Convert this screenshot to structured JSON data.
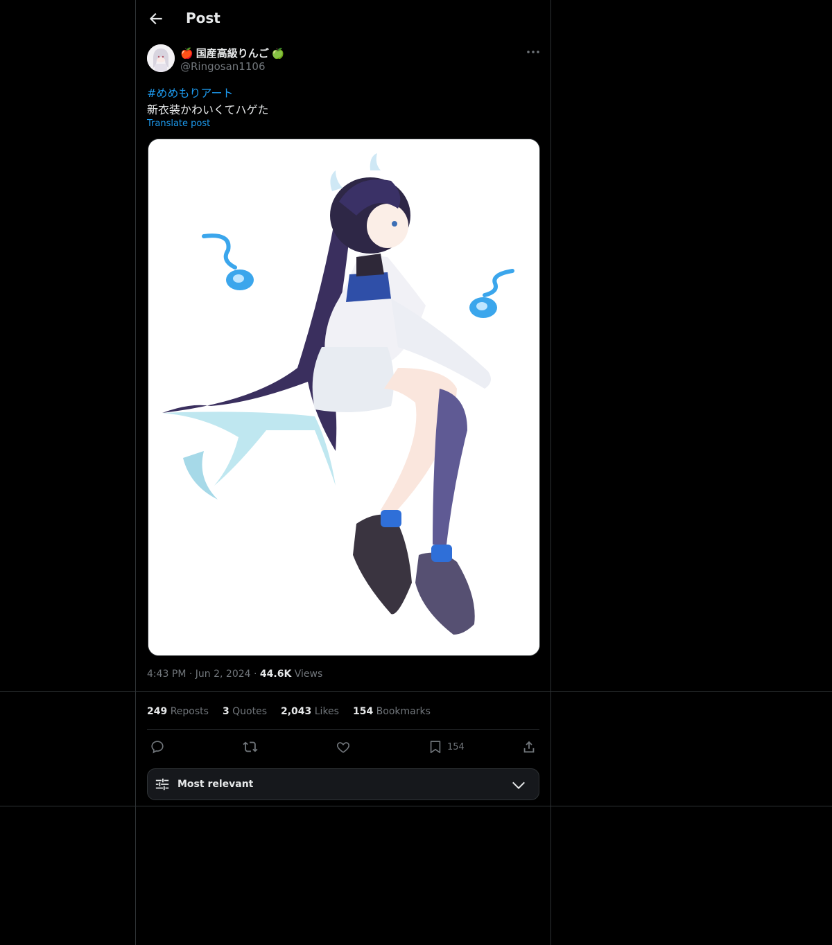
{
  "header": {
    "title": "Post"
  },
  "author": {
    "name": "国産高級りんご",
    "name_prefix_emoji": "🍎",
    "name_suffix_emoji": "🍏",
    "handle": "@Ringosan1106"
  },
  "post": {
    "hashtag": "#めめもりアート",
    "text": "新衣装かわいくてハゲた",
    "translate_label": "Translate post",
    "time": "4:43 PM",
    "date": "Jun 2, 2024",
    "views_count": "44.6K",
    "views_label": "Views"
  },
  "stats": {
    "reposts_count": "249",
    "reposts_label": "Reposts",
    "quotes_count": "3",
    "quotes_label": "Quotes",
    "likes_count": "2,043",
    "likes_label": "Likes",
    "bookmarks_count": "154",
    "bookmarks_label": "Bookmarks"
  },
  "actions": {
    "bookmark_count": "154"
  },
  "sort": {
    "label": "Most relevant"
  },
  "colors": {
    "accent": "#1d9bf0",
    "muted": "#71767b",
    "text": "#e7e9ea",
    "border": "#2f3336"
  },
  "icons": [
    "back-arrow-icon",
    "more-icon",
    "reply-icon",
    "repost-icon",
    "like-icon",
    "bookmark-icon",
    "share-icon",
    "sliders-icon",
    "chevron-down-icon"
  ]
}
